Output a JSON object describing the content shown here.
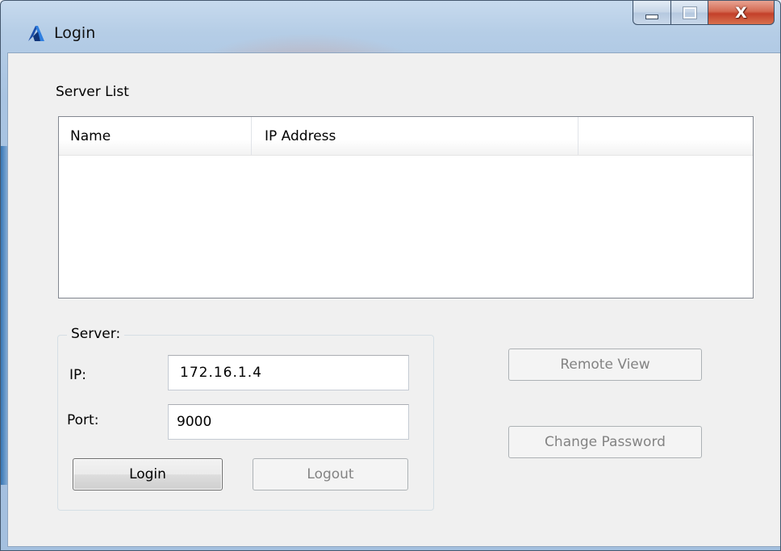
{
  "window": {
    "title": "Login",
    "icon": "app-logo-icon",
    "controls": {
      "minimize": "minimize-icon",
      "maximize": "maximize-icon",
      "close_label": "X"
    }
  },
  "server_list": {
    "label": "Server List",
    "columns": [
      "Name",
      "IP Address",
      ""
    ],
    "rows": []
  },
  "server_group": {
    "title": "Server:",
    "ip_label": "IP:",
    "ip_value": "172.16.1.4",
    "port_label": "Port:",
    "port_value": "9000"
  },
  "buttons": {
    "login": "Login",
    "logout": "Logout",
    "remote_view": "Remote View",
    "change_password": "Change Password"
  },
  "colors": {
    "close_button": "#c9442e",
    "frame": "#b5cde6",
    "client_background": "#f0f0f0"
  }
}
